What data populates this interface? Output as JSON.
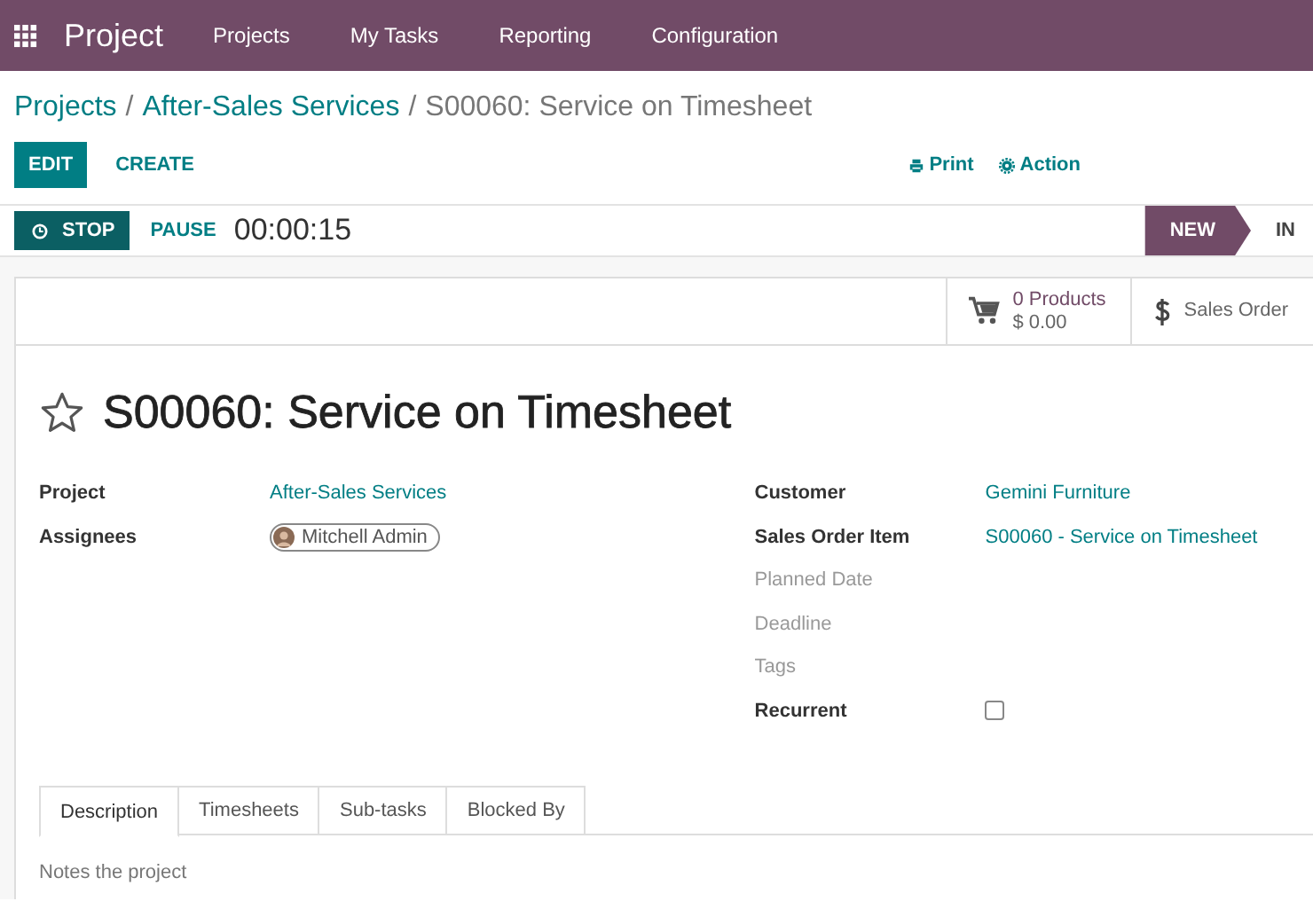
{
  "navbar": {
    "app_title": "Project",
    "menu": [
      "Projects",
      "My Tasks",
      "Reporting",
      "Configuration"
    ]
  },
  "breadcrumb": [
    {
      "label": "Projects",
      "link": true
    },
    {
      "label": "After-Sales Services",
      "link": true,
      "separator": "/"
    },
    {
      "label": "S00060: Service on Timesheet",
      "link": false,
      "separator": "/"
    }
  ],
  "control_buttons": [
    {
      "label": "EDIT",
      "primary": true
    },
    {
      "label": "CREATE",
      "primary": false
    }
  ],
  "actions": [
    {
      "label": "Print",
      "kind": "print"
    },
    {
      "label": "Action",
      "kind": "gear"
    }
  ],
  "timer": {
    "stop_label": "STOP",
    "pause_label": "PAUSE",
    "elapsed": "00:00:15"
  },
  "stages": [
    {
      "label": "NEW",
      "selected": true
    },
    {
      "label": "IN",
      "selected": false
    }
  ],
  "smart_buttons": [
    {
      "kind": "cart",
      "lines": [
        "0 Products",
        "$ 0.00"
      ]
    },
    {
      "kind": "dollar",
      "lines": [
        "Sales Order"
      ]
    }
  ],
  "title": {
    "text": "S00060: Service on Timesheet",
    "starred": false
  },
  "left_fields": [
    {
      "label": "Project",
      "kind": "link",
      "value": "After-Sales Services",
      "filled": true
    },
    {
      "label": "Assignees",
      "kind": "tag",
      "value": "Mitchell Admin",
      "filled": true
    }
  ],
  "right_fields": [
    {
      "label": "Customer",
      "kind": "link",
      "value": "Gemini Furniture",
      "filled": true
    },
    {
      "label": "Sales Order Item",
      "kind": "link",
      "value": "S00060 - Service on Timesheet",
      "filled": true
    },
    {
      "label": "Planned Date",
      "kind": "empty",
      "filled": false
    },
    {
      "label": "Deadline",
      "kind": "empty",
      "filled": false
    },
    {
      "label": "Tags",
      "kind": "empty",
      "filled": false
    },
    {
      "label": "Recurrent",
      "kind": "checkbox",
      "checked": false,
      "filled": true
    }
  ],
  "tabs": [
    {
      "label": "Description",
      "selected": true
    },
    {
      "label": "Timesheets",
      "selected": false
    },
    {
      "label": "Sub-tasks",
      "selected": false
    },
    {
      "label": "Blocked By",
      "selected": false
    }
  ],
  "description": {
    "placeholder": "Notes the project"
  }
}
